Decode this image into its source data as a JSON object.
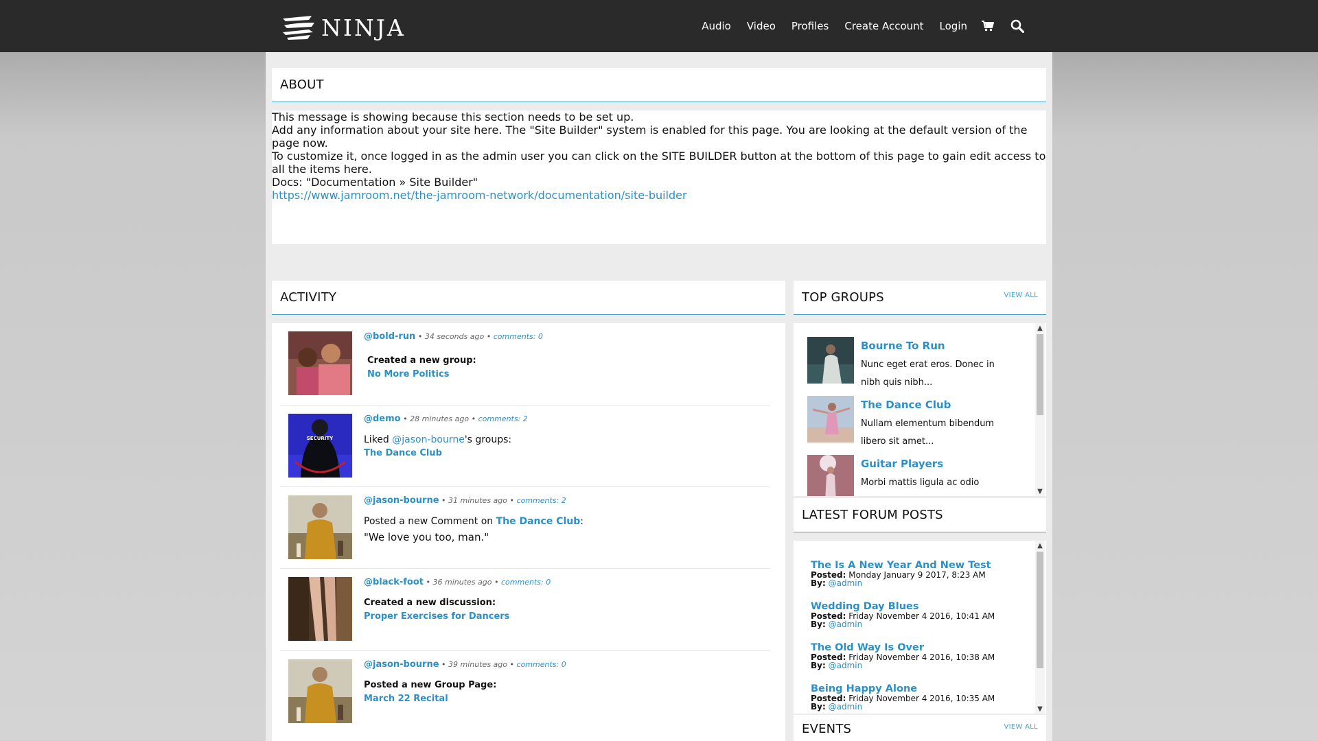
{
  "header": {
    "logo_text": "NINJA",
    "nav": [
      "Audio",
      "Video",
      "Profiles",
      "Create Account",
      "Login"
    ],
    "icons": [
      "cart-icon",
      "search-icon"
    ]
  },
  "about": {
    "title": "ABOUT",
    "p1": "This message is showing because this section needs to be set up.",
    "p2": "Add any information about your site here.  The \"Site Builder\" system is enabled for this page.  You are looking at the default version of the page now.",
    "p3": "To customize it, once logged in as the admin user you can click on the SITE BUILDER button at the bottom of this page to gain edit access to all the items here.",
    "p4": "Docs: \"Documentation » Site Builder\"",
    "link": "https://www.jamroom.net/the-jamroom-network/documentation/site-builder"
  },
  "activity": {
    "title": "ACTIVITY",
    "items": [
      {
        "user": "@bold-run",
        "time": "34 seconds ago",
        "comments": "comments: 0",
        "line1": "Created a new group:",
        "line2": "No More Politics"
      },
      {
        "user": "@demo",
        "time": "28 minutes ago",
        "comments": "comments: 2",
        "pre": "Liked ",
        "mention": "@jason-bourne",
        "post": "'s groups:",
        "line2": "The Dance Club"
      },
      {
        "user": "@jason-bourne",
        "time": "31 minutes ago",
        "comments": "comments: 2",
        "pre": "Posted a new Comment on ",
        "target": "The Dance Club",
        "colon": ":",
        "quote": "\"We love you too, man.\""
      },
      {
        "user": "@black-foot",
        "time": "36 minutes ago",
        "comments": "comments: 0",
        "line1": "Created a new discussion:",
        "line2": "Proper Exercises for Dancers"
      },
      {
        "user": "@jason-bourne",
        "time": "39 minutes ago",
        "comments": "comments: 0",
        "line1": "Posted a new Group Page:",
        "line2": "March 22 Recital"
      }
    ],
    "separator": "•"
  },
  "top_groups": {
    "title": "TOP GROUPS",
    "view_all": "VIEW ALL",
    "items": [
      {
        "name": "Bourne To Run",
        "desc": "Nunc eget erat eros. Donec in nibh quis nibh..."
      },
      {
        "name": "The Dance Club",
        "desc": "Nullam elementum bibendum libero sit amet..."
      },
      {
        "name": "Guitar Players",
        "desc": "Morbi mattis ligula ac odio"
      }
    ]
  },
  "forum": {
    "title": "LATEST FORUM POSTS",
    "posted_label": "Posted:",
    "by_label": "By:",
    "items": [
      {
        "title": "The Is A New Year And New Test",
        "posted": "Monday January 9 2017, 8:23 AM",
        "by": "@admin"
      },
      {
        "title": "Wedding Day Blues",
        "posted": "Friday November 4 2016, 10:41 AM",
        "by": "@admin"
      },
      {
        "title": "The Old Way Is Over",
        "posted": "Friday November 4 2016, 10:38 AM",
        "by": "@admin"
      },
      {
        "title": "Being Happy Alone",
        "posted": "Friday November 4 2016, 10:35 AM",
        "by": "@admin"
      }
    ]
  },
  "events": {
    "title": "EVENTS",
    "view_all": "VIEW ALL"
  }
}
